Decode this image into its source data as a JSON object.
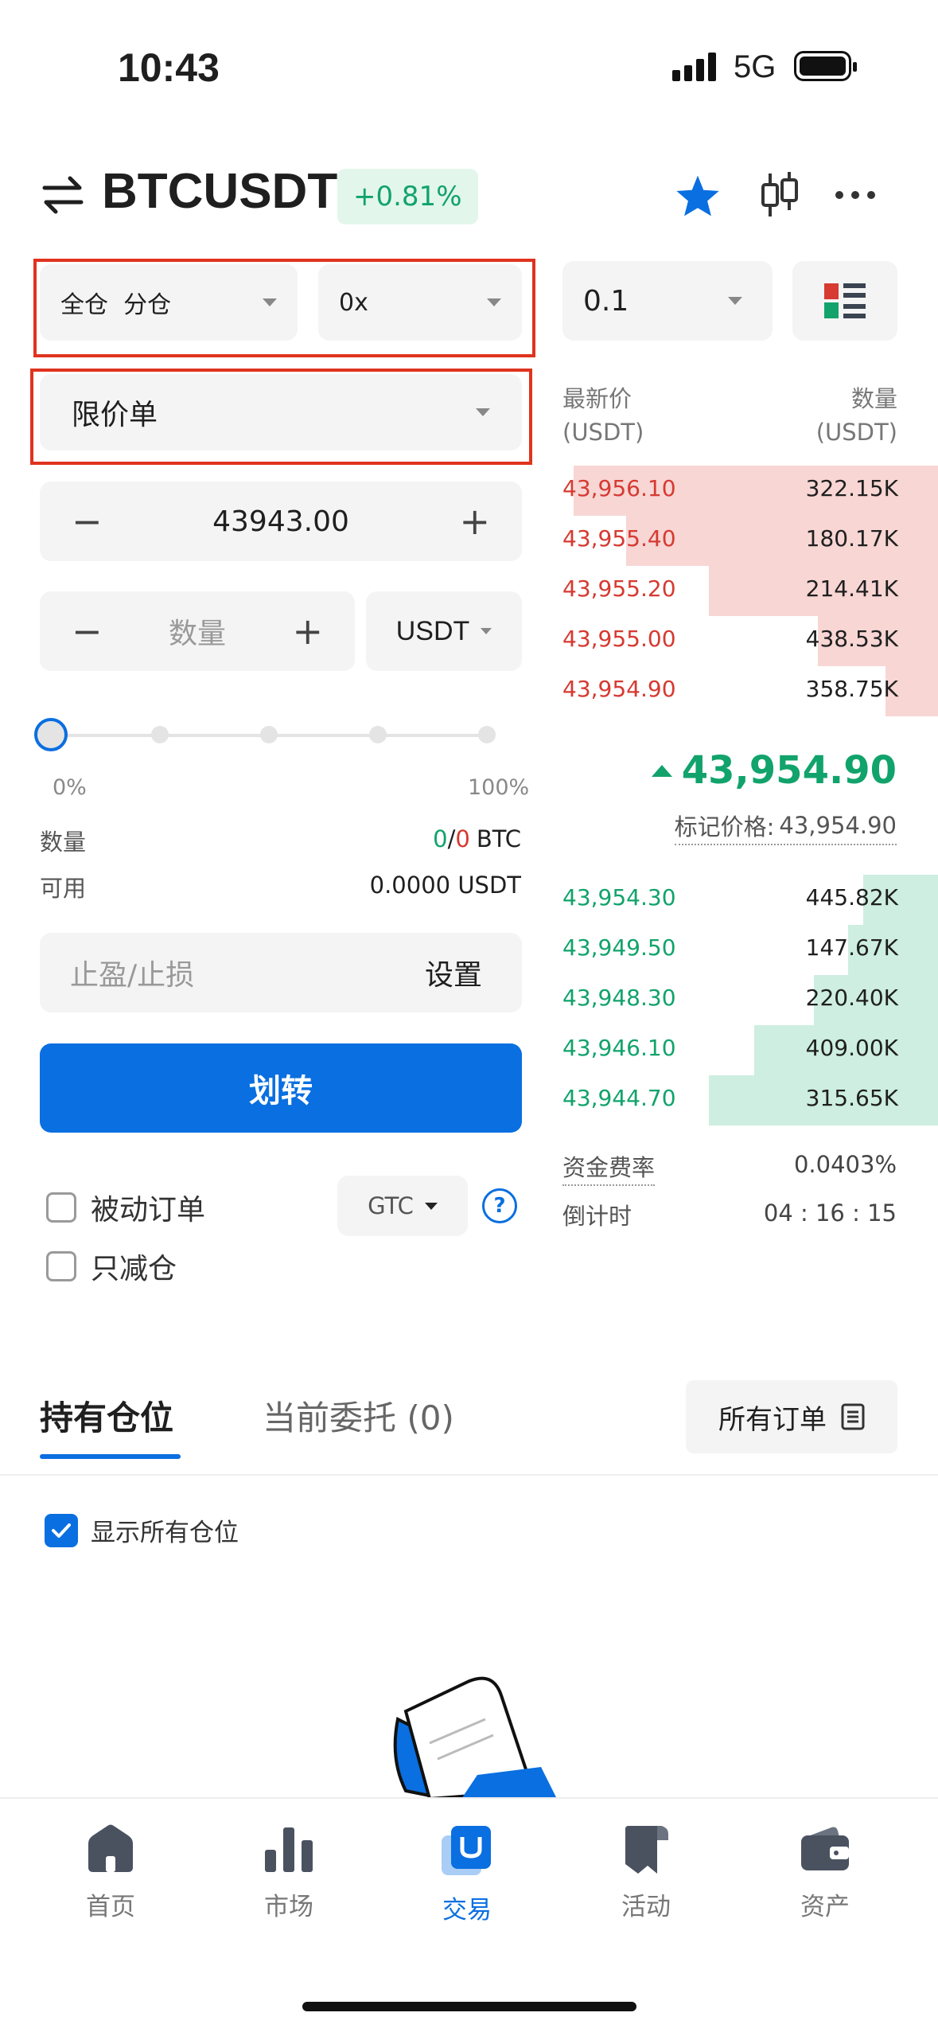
{
  "status_bar": {
    "time": "10:43",
    "network": "5G"
  },
  "header": {
    "symbol": "BTCUSDT",
    "change": "+0.81%"
  },
  "margin_mode": {
    "label": "全仓  分仓"
  },
  "leverage": {
    "value": "0x"
  },
  "order_type": {
    "value": "限价单"
  },
  "price_input": {
    "value": "43943.00"
  },
  "qty_input": {
    "placeholder": "数量",
    "unit": "USDT"
  },
  "slider": {
    "value_percent": 0,
    "min_label": "0%",
    "max_label": "100%"
  },
  "info": {
    "qty_label": "数量",
    "qty_value_a": "0",
    "qty_sep": "/",
    "qty_value_b": "0",
    "qty_unit": "BTC",
    "avail_label": "可用",
    "avail_value": "0.0000 USDT"
  },
  "tpsl": {
    "label": "止盈/止损",
    "action": "设置"
  },
  "transfer_button": {
    "label": "划转"
  },
  "options": {
    "post_only": "被动订单",
    "reduce_only": "只减仓",
    "tif": "GTC",
    "help": "?"
  },
  "orderbook": {
    "precision": "0.1",
    "price_header_1": "最新价",
    "price_header_2": "(USDT)",
    "qty_header_1": "数量",
    "qty_header_2": "(USDT)",
    "asks": [
      {
        "price": "43,956.10",
        "amount": "322.15K",
        "depth": 0.3
      },
      {
        "price": "43,955.40",
        "amount": "180.17K",
        "depth": 0.43
      },
      {
        "price": "43,955.20",
        "amount": "214.41K",
        "depth": 0.58
      },
      {
        "price": "43,955.00",
        "amount": "438.53K",
        "depth": 0.7
      },
      {
        "price": "43,954.90",
        "amount": "358.75K",
        "depth": 0.86
      }
    ],
    "last_price": "43,954.90",
    "mark_price_label": "标记价格:",
    "mark_price": "43,954.90",
    "bids": [
      {
        "price": "43,954.30",
        "amount": "445.82K",
        "depth": 0.8
      },
      {
        "price": "43,949.50",
        "amount": "147.67K",
        "depth": 0.6
      },
      {
        "price": "43,948.30",
        "amount": "220.40K",
        "depth": 0.7
      },
      {
        "price": "43,946.10",
        "amount": "409.00K",
        "depth": 0.87
      },
      {
        "price": "43,944.70",
        "amount": "315.65K",
        "depth": 0.96
      }
    ],
    "funding_label": "资金费率",
    "funding_value": "0.0403%",
    "countdown_label": "倒计时",
    "countdown_value": "04 : 16 : 15"
  },
  "tabs": {
    "positions": "持有仓位",
    "open_orders": "当前委托 (0)",
    "all_orders": "所有订单"
  },
  "show_all": {
    "label": "显示所有仓位"
  },
  "bottom_nav": [
    {
      "label": "首页",
      "icon": "home-icon"
    },
    {
      "label": "市场",
      "icon": "market-icon"
    },
    {
      "label": "交易",
      "icon": "trade-icon",
      "active": true
    },
    {
      "label": "活动",
      "icon": "activity-icon"
    },
    {
      "label": "资产",
      "icon": "assets-icon"
    }
  ],
  "colors": {
    "accent": "#0a6fe0",
    "up": "#11a36b",
    "down": "#d63a31"
  }
}
